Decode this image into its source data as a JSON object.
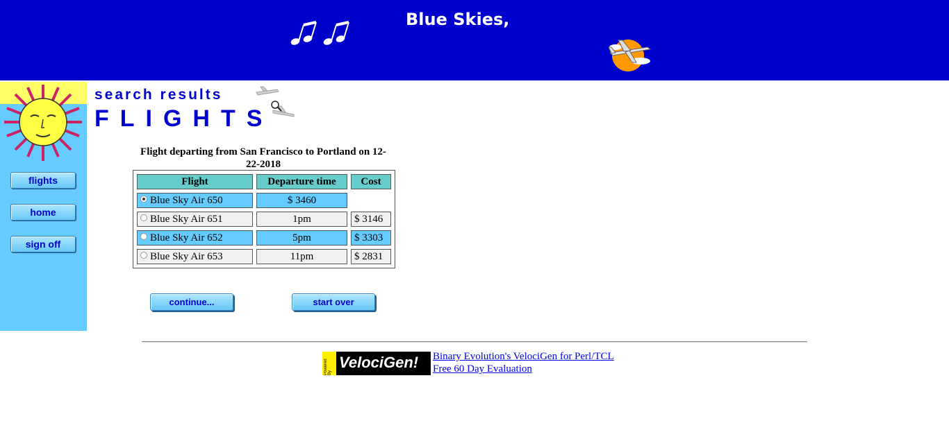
{
  "banner": {
    "title": "Blue Skies,",
    "notes_icon": "music-notes-icon",
    "plane_icon": "airplane-sun-icon"
  },
  "sidebar": {
    "logo_icon": "sun-face-icon",
    "buttons": [
      {
        "label": "flights"
      },
      {
        "label": "home"
      },
      {
        "label": "sign off"
      }
    ]
  },
  "heading": {
    "subtitle": "search results",
    "title": "FLIGHTS",
    "graphic_icon": "search-magnifier-icon"
  },
  "results": {
    "caption": "Flight departing from San Francisco to Portland on 12-22-2018",
    "columns": [
      "Flight",
      "Departure time",
      "Cost"
    ],
    "rows": [
      {
        "flight": "Blue Sky Air 650",
        "departure": "$ 3460",
        "cost": "",
        "selected": true
      },
      {
        "flight": "Blue Sky Air 651",
        "departure": "1pm",
        "cost": "$ 3146",
        "selected": false
      },
      {
        "flight": "Blue Sky Air 652",
        "departure": "5pm",
        "cost": "$ 3303",
        "selected": false
      },
      {
        "flight": "Blue Sky Air 653",
        "departure": "11pm",
        "cost": "$ 2831",
        "selected": false
      }
    ]
  },
  "actions": {
    "continue_label": "continue...",
    "start_over_label": "start over"
  },
  "footer": {
    "logo_small": "Powered By",
    "logo_brand": "VelociGen!",
    "link1": "Binary Evolution's VelociGen for Perl/TCL",
    "link2": "Free 60 Day Evaluation"
  },
  "colors": {
    "banner": "#0000cc",
    "sidebar": "#66ccff",
    "header_cell": "#66cccc",
    "highlight_row": "#66ccff"
  }
}
